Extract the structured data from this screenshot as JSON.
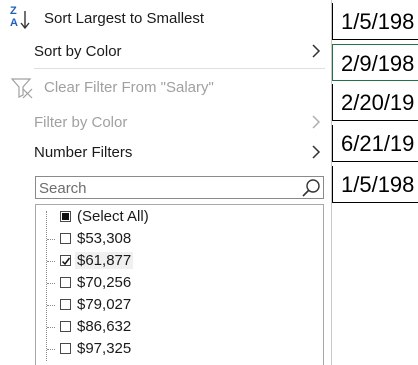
{
  "menu": {
    "sort_desc": {
      "label": "Sort Largest to Smallest",
      "icon": "sort-descending-icon",
      "icon_top": "Z",
      "icon_bottom": "A"
    },
    "sort_by_color": {
      "label": "Sort by Color"
    },
    "clear_filter": {
      "label": "Clear Filter From \"Salary\"",
      "icon": "clear-filter-icon"
    },
    "filter_by_color": {
      "label": "Filter by Color"
    },
    "number_filters": {
      "label": "Number Filters"
    }
  },
  "search": {
    "placeholder": "Search",
    "icon": "search-icon"
  },
  "filter_list": {
    "items": [
      {
        "label": "(Select All)",
        "state": "partial"
      },
      {
        "label": "$53,308",
        "state": "unchecked"
      },
      {
        "label": "$61,877",
        "state": "checked"
      },
      {
        "label": "$70,256",
        "state": "unchecked"
      },
      {
        "label": "$79,027",
        "state": "unchecked"
      },
      {
        "label": "$86,632",
        "state": "unchecked"
      },
      {
        "label": "$97,325",
        "state": "unchecked"
      }
    ]
  },
  "sheet": {
    "cells": [
      "1/5/198",
      "2/9/198",
      "2/20/19",
      "6/21/19",
      "1/5/198"
    ]
  },
  "colors": {
    "selected_cell_border": "#217346",
    "disabled_text": "#a0a0a0"
  }
}
